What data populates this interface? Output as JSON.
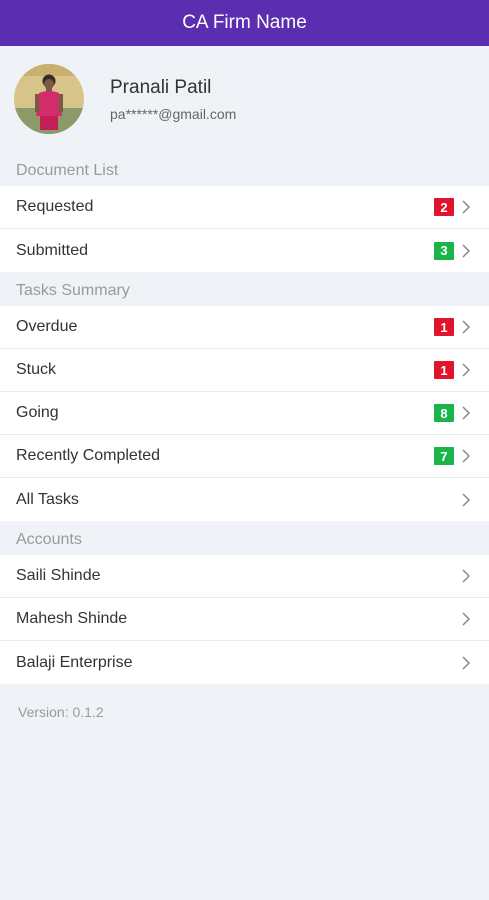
{
  "header": {
    "title": "CA Firm Name"
  },
  "profile": {
    "name": "Pranali Patil",
    "email": "pa******@gmail.com"
  },
  "colors": {
    "header": "#5b2db0",
    "badge_red": "#e0142c",
    "badge_green": "#1ab44b"
  },
  "documents": {
    "title": "Document List",
    "items": [
      {
        "label": "Requested",
        "count": "2",
        "color": "red"
      },
      {
        "label": "Submitted",
        "count": "3",
        "color": "green"
      }
    ]
  },
  "tasks": {
    "title": "Tasks Summary",
    "items": [
      {
        "label": "Overdue",
        "count": "1",
        "color": "red"
      },
      {
        "label": "Stuck",
        "count": "1",
        "color": "red"
      },
      {
        "label": "Going",
        "count": "8",
        "color": "green"
      },
      {
        "label": "Recently Completed",
        "count": "7",
        "color": "green"
      },
      {
        "label": "All Tasks"
      }
    ]
  },
  "accounts": {
    "title": "Accounts",
    "items": [
      {
        "label": "Saili Shinde"
      },
      {
        "label": "Mahesh Shinde"
      },
      {
        "label": "Balaji Enterprise"
      }
    ]
  },
  "footer": {
    "version": "Version: 0.1.2"
  }
}
